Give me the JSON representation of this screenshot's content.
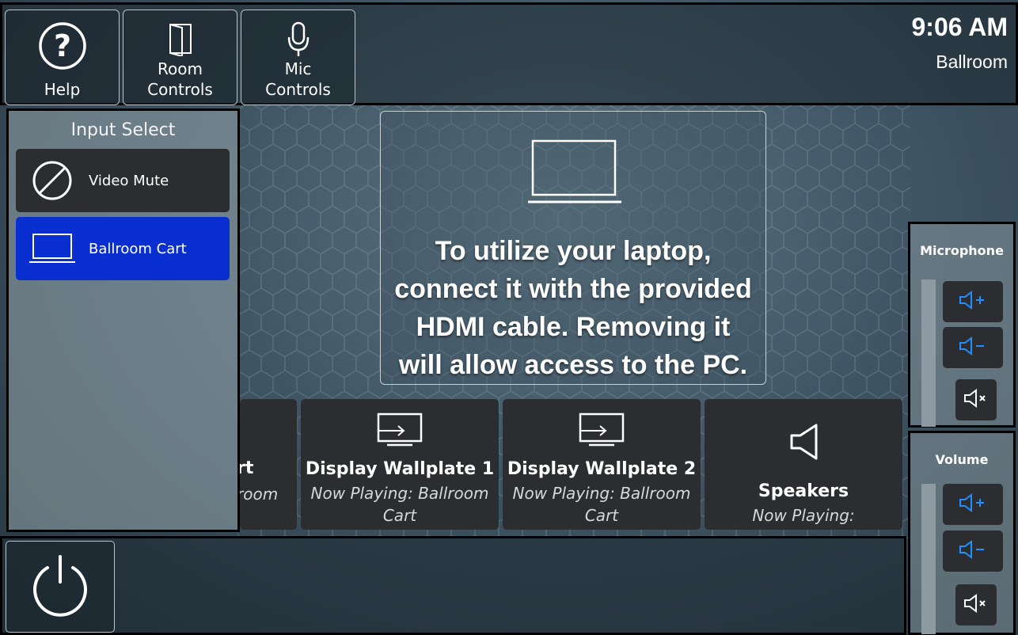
{
  "header": {
    "help_label": "Help",
    "room_controls_label": [
      "Room",
      "Controls"
    ],
    "mic_controls_label": [
      "Mic",
      "Controls"
    ],
    "time": "9:06 AM",
    "room_name": "Ballroom"
  },
  "input_select": {
    "title": "Input Select",
    "items": [
      {
        "label": "Video Mute",
        "icon": "no-symbol-icon",
        "active": false
      },
      {
        "label": "Ballroom Cart",
        "icon": "laptop-icon",
        "active": true
      }
    ]
  },
  "message": {
    "icon": "laptop-icon",
    "lines": [
      "To utilize your laptop,",
      "connect it with the provided",
      "HDMI cable. Removing it",
      "will allow access to the PC."
    ]
  },
  "destinations": [
    {
      "name_partial": "rt",
      "now_playing_partial": "room"
    },
    {
      "name": "Display Wallplate 1",
      "now_playing": [
        "Now Playing: Ballroom",
        "Cart"
      ],
      "icon": "display-input-icon"
    },
    {
      "name": "Display Wallplate 2",
      "now_playing": [
        "Now Playing: Ballroom",
        "Cart"
      ],
      "icon": "display-input-icon"
    },
    {
      "name": "Speakers",
      "now_playing": [
        "Now Playing:"
      ],
      "icon": "speaker-icon"
    }
  ],
  "microphone": {
    "title": "Microphone",
    "level": 0
  },
  "volume": {
    "title": "Volume",
    "level": 0
  },
  "colors": {
    "accent": "#0a2fd0",
    "volume_icon": "#1e90ff",
    "button_bg": "#2b2d30"
  }
}
